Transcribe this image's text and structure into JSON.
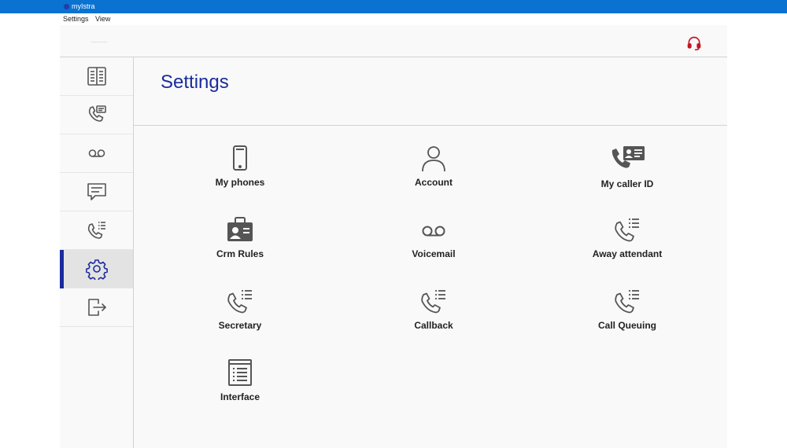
{
  "window": {
    "title": "myIstra"
  },
  "menubar": {
    "items": [
      "Settings",
      "View"
    ]
  },
  "topbar": {
    "icons": [
      "headset-icon"
    ],
    "accent": "#c0191f"
  },
  "sidebar": {
    "items": [
      {
        "icon": "contacts-book-icon"
      },
      {
        "icon": "call-history-icon"
      },
      {
        "icon": "voicemail-icon"
      },
      {
        "icon": "chat-icon"
      },
      {
        "icon": "call-list-icon"
      },
      {
        "icon": "gear-icon",
        "active": true
      },
      {
        "icon": "logout-icon"
      }
    ],
    "active_color": "#1a2b9c"
  },
  "main": {
    "title": "Settings",
    "tiles": [
      {
        "label": "My phones",
        "icon": "smartphone-icon"
      },
      {
        "label": "Account",
        "icon": "person-icon"
      },
      {
        "label": "My caller ID",
        "icon": "caller-id-icon"
      },
      {
        "label": "Crm Rules",
        "icon": "crm-badge-icon"
      },
      {
        "label": "Voicemail",
        "icon": "voicemail-icon"
      },
      {
        "label": "Away attendant",
        "icon": "phone-list-icon"
      },
      {
        "label": "Secretary",
        "icon": "phone-list-icon"
      },
      {
        "label": "Callback",
        "icon": "phone-list-icon"
      },
      {
        "label": "Call Queuing",
        "icon": "phone-list-icon"
      },
      {
        "label": "Interface",
        "icon": "form-list-icon"
      }
    ]
  }
}
